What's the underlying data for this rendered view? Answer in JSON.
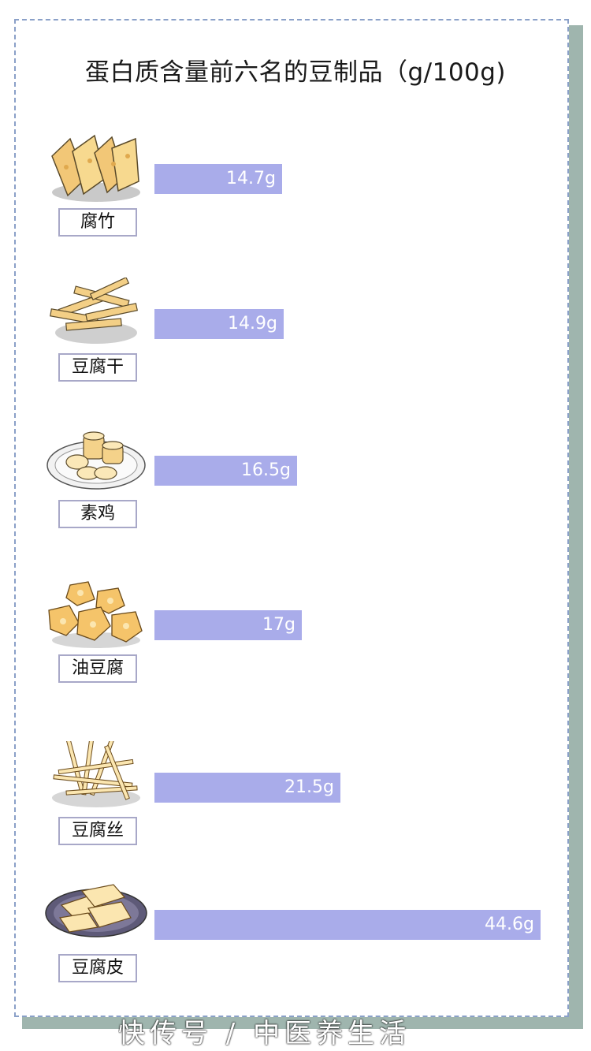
{
  "title": "蛋白质含量前六名的豆制品（g/100g)",
  "watermark": "快传号 / 中医养生活",
  "colors": {
    "bar": "#a9acea",
    "frame": "#9fb5ae",
    "border": "#8aa0c8"
  },
  "chart_data": {
    "type": "bar",
    "orientation": "horizontal",
    "title": "蛋白质含量前六名的豆制品（g/100g)",
    "categories": [
      "腐竹",
      "豆腐干",
      "素鸡",
      "油豆腐",
      "豆腐丝",
      "豆腐皮"
    ],
    "values": [
      14.7,
      14.9,
      16.5,
      17,
      21.5,
      44.6
    ],
    "value_labels": [
      "14.7g",
      "14.9g",
      "16.5g",
      "17g",
      "21.5g",
      "44.6g"
    ],
    "unit": "g",
    "xlim": [
      0,
      44.6
    ],
    "grid": false,
    "legend": "none"
  },
  "items": [
    {
      "label": "腐竹",
      "icon": "yuba-sheets-icon"
    },
    {
      "label": "豆腐干",
      "icon": "dried-tofu-strips-icon"
    },
    {
      "label": "素鸡",
      "icon": "vegetarian-chicken-plate-icon"
    },
    {
      "label": "油豆腐",
      "icon": "fried-tofu-puffs-icon"
    },
    {
      "label": "豆腐丝",
      "icon": "tofu-shreds-icon"
    },
    {
      "label": "豆腐皮",
      "icon": "tofu-skin-plate-icon"
    }
  ]
}
